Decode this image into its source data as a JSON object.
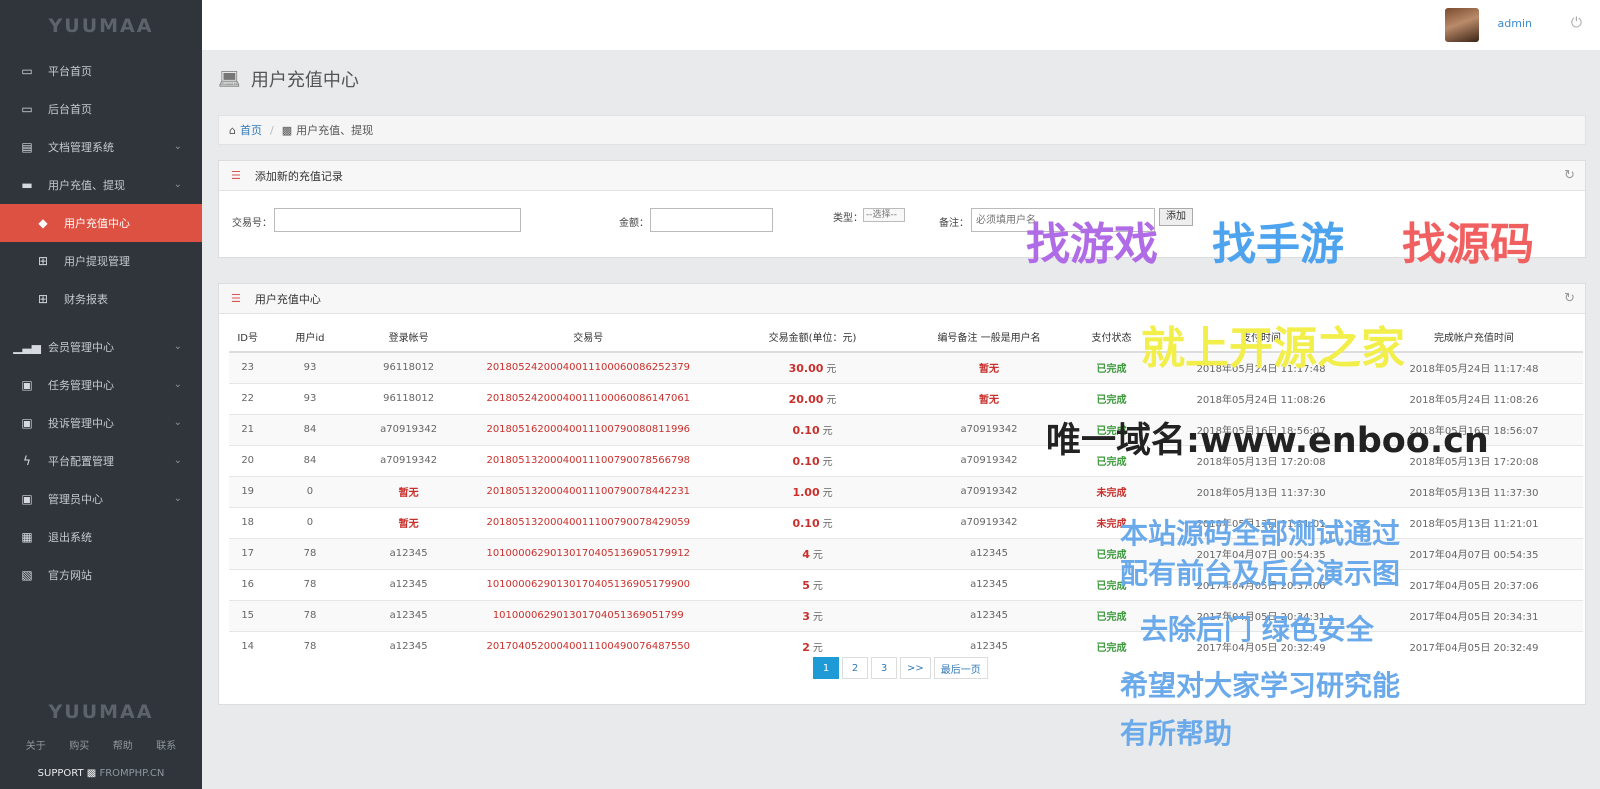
{
  "sidebar": {
    "brand": "YUUMAA",
    "items": [
      {
        "label": "平台首页",
        "icon": "laptop-icon"
      },
      {
        "label": "后台首页",
        "icon": "laptop-icon"
      },
      {
        "label": "文档管理系统",
        "icon": "file-icon"
      },
      {
        "label": "用户充值、提现",
        "icon": "card-icon"
      },
      {
        "label": "用户充值中心",
        "icon": "tag-icon"
      },
      {
        "label": "用户提现管理",
        "icon": "plus-square-icon"
      },
      {
        "label": "财务报表",
        "icon": "plus-square-icon"
      },
      {
        "label": "会员管理中心",
        "icon": "signal-icon"
      },
      {
        "label": "任务管理中心",
        "icon": "briefcase-icon"
      },
      {
        "label": "投诉管理中心",
        "icon": "briefcase-icon"
      },
      {
        "label": "平台配置管理",
        "icon": "bolt-icon"
      },
      {
        "label": "管理员中心",
        "icon": "briefcase-icon"
      },
      {
        "label": "退出系统",
        "icon": "calendar-icon"
      },
      {
        "label": "官方网站",
        "icon": "picture-icon"
      }
    ],
    "footer": {
      "brand": "YUUMAA",
      "links": [
        "关于",
        "购买",
        "帮助",
        "联系"
      ],
      "support_label": "SUPPORT",
      "support_site": "FROMPHP.CN"
    }
  },
  "topbar": {
    "user": "admin"
  },
  "page": {
    "title": "用户充值中心",
    "breadcrumb_home": "首页",
    "breadcrumb_current": "用户充值、提现"
  },
  "add_panel": {
    "title": "添加新的充值记录",
    "trade_label": "交易号：",
    "amount_label": "金额：",
    "type_label": "类型：",
    "type_value": "--选择--",
    "note_label": "备注：",
    "note_placeholder": "必须填用户名",
    "add_button": "添加"
  },
  "list_panel": {
    "title": "用户充值中心",
    "columns": [
      "ID号",
      "用户id",
      "登录帐号",
      "交易号",
      "交易金额(单位：元)",
      "编号备注 一般是用户名",
      "支付状态",
      "支付时间",
      "完成帐户充值时间"
    ],
    "currency": "元",
    "rows": [
      {
        "id": "23",
        "uid": "93",
        "account": "96118012",
        "trade": "2018052420004001110006008625237​9",
        "amount": "30.00",
        "note": "暂无",
        "status": "已完成",
        "paid": "2018年05月24日 11:17:48",
        "done": "2018年05月24日 11:17:48"
      },
      {
        "id": "22",
        "uid": "93",
        "account": "96118012",
        "trade": "2018052420004001110006008614706​1",
        "amount": "20.00",
        "note": "暂无",
        "status": "已完成",
        "paid": "2018年05月24日 11:08:26",
        "done": "2018年05月24日 11:08:26"
      },
      {
        "id": "21",
        "uid": "84",
        "account": "a70919342",
        "trade": "2018051620004001110079008081199​6",
        "amount": "0.10",
        "note": "a70919342",
        "status": "已完成",
        "paid": "2018年05月16日 18:56:07",
        "done": "2018年05月16日 18:56:07"
      },
      {
        "id": "20",
        "uid": "84",
        "account": "a70919342",
        "trade": "2018051320004001110079007856679​8",
        "amount": "0.10",
        "note": "a70919342",
        "status": "已完成",
        "paid": "2018年05月13日 17:20:08",
        "done": "2018年05月13日 17:20:08"
      },
      {
        "id": "19",
        "uid": "0",
        "account": "暂无",
        "trade": "2018051320004001110079007844223​1",
        "amount": "1.00",
        "note": "a70919342",
        "status": "未完成",
        "paid": "2018年05月13日 11:37:30",
        "done": "2018年05月13日 11:37:30"
      },
      {
        "id": "18",
        "uid": "0",
        "account": "暂无",
        "trade": "2018051320004001110079007842905​9",
        "amount": "0.10",
        "note": "a70919342",
        "status": "未完成",
        "paid": "2018年05月13日 11:21:01",
        "done": "2018年05月13日 11:21:01"
      },
      {
        "id": "17",
        "uid": "78",
        "account": "a12345",
        "trade": "1010000629013017040513690517991​2",
        "amount": "4",
        "note": "a12345",
        "status": "已完成",
        "paid": "2017年04月07日 00:54:35",
        "done": "2017年04月07日 00:54:35"
      },
      {
        "id": "16",
        "uid": "78",
        "account": "a12345",
        "trade": "1010000629013017040513690517990​0",
        "amount": "5",
        "note": "a12345",
        "status": "已完成",
        "paid": "2017年04月05日 20:37:06",
        "done": "2017年04月05日 20:37:06"
      },
      {
        "id": "15",
        "uid": "78",
        "account": "a12345",
        "trade": "10100006290130170405136905179​9",
        "amount": "3",
        "note": "a12345",
        "status": "已完成",
        "paid": "2017年04月05日 20:34:31",
        "done": "2017年04月05日 20:34:31"
      },
      {
        "id": "14",
        "uid": "78",
        "account": "a12345",
        "trade": "2017040520004001110049007648755​0",
        "amount": "2",
        "note": "a12345",
        "status": "已完成",
        "paid": "2017年04月05日 20:32:49",
        "done": "2017年04月05日 20:32:49"
      }
    ],
    "pagination": [
      "1",
      "2",
      "3",
      ">>",
      "最后一页"
    ]
  },
  "watermark": {
    "a": "找游戏",
    "b": "找手游",
    "c": "找源码",
    "d": "就上开源之家",
    "e": "唯一域名:www.enboo.cn",
    "f": "本站源码全部测试通过",
    "g": "配有前台及后台演示图",
    "h": "去除后门 绿色安全",
    "i": "希望对大家学习研究能",
    "j": "有所帮助"
  }
}
